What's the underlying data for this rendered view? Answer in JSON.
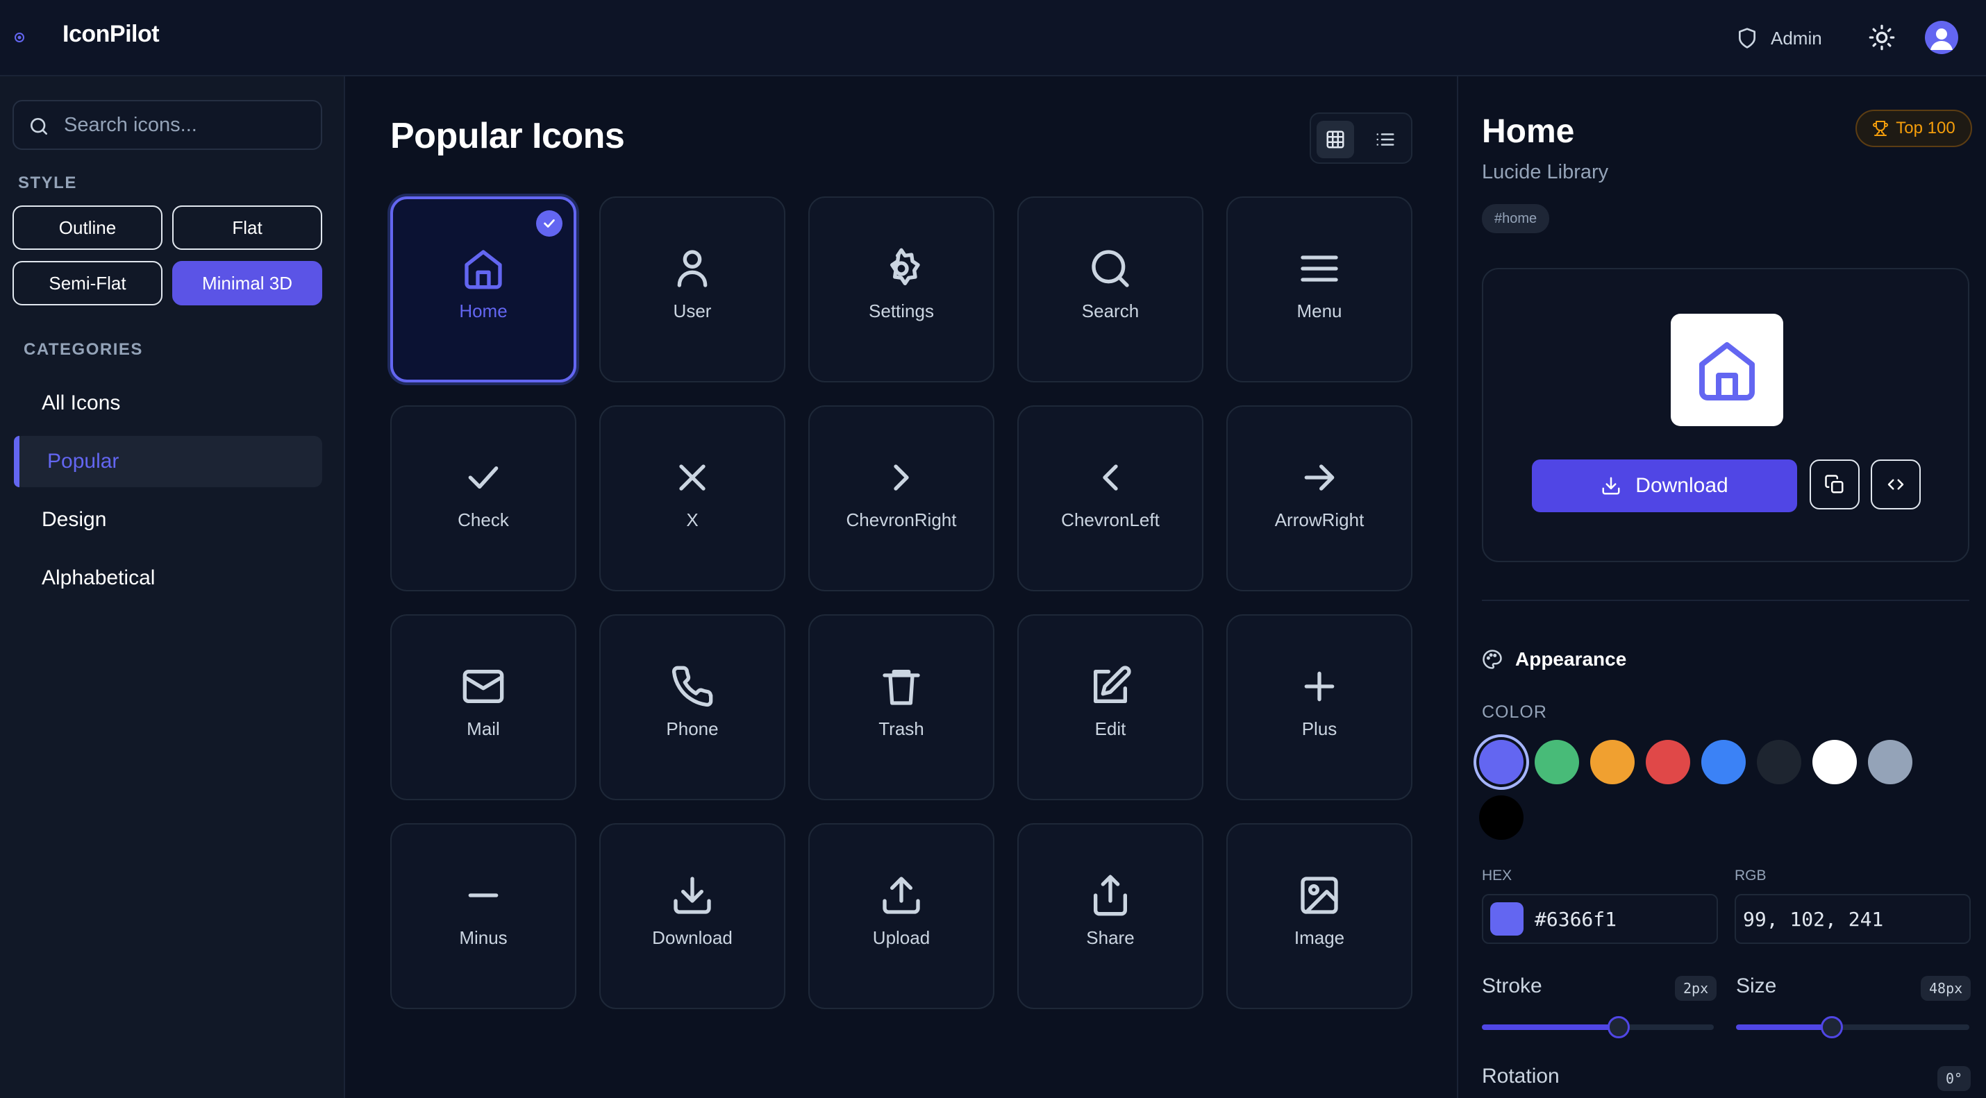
{
  "app": {
    "name": "IconPilot"
  },
  "header": {
    "role_label": "Admin"
  },
  "sidebar": {
    "search_placeholder": "Search icons...",
    "style_label": "STYLE",
    "styles": [
      {
        "label": "Outline",
        "active": false
      },
      {
        "label": "Flat",
        "active": false
      },
      {
        "label": "Semi-Flat",
        "active": false
      },
      {
        "label": "Minimal 3D",
        "active": true
      }
    ],
    "categories_label": "CATEGORIES",
    "categories": [
      {
        "label": "All Icons",
        "active": false
      },
      {
        "label": "Popular",
        "active": true
      },
      {
        "label": "Design",
        "active": false
      },
      {
        "label": "Alphabetical",
        "active": false
      }
    ]
  },
  "main": {
    "title": "Popular Icons",
    "view_mode": "grid",
    "icons": [
      {
        "label": "Home",
        "icon": "home-icon",
        "selected": true
      },
      {
        "label": "User",
        "icon": "user-icon"
      },
      {
        "label": "Settings",
        "icon": "settings-icon"
      },
      {
        "label": "Search",
        "icon": "search-icon"
      },
      {
        "label": "Menu",
        "icon": "menu-icon"
      },
      {
        "label": "Check",
        "icon": "check-icon"
      },
      {
        "label": "X",
        "icon": "x-icon"
      },
      {
        "label": "ChevronRight",
        "icon": "chevron-right-icon"
      },
      {
        "label": "ChevronLeft",
        "icon": "chevron-left-icon"
      },
      {
        "label": "ArrowRight",
        "icon": "arrow-right-icon"
      },
      {
        "label": "Mail",
        "icon": "mail-icon"
      },
      {
        "label": "Phone",
        "icon": "phone-icon"
      },
      {
        "label": "Trash",
        "icon": "trash-icon"
      },
      {
        "label": "Edit",
        "icon": "edit-icon"
      },
      {
        "label": "Plus",
        "icon": "plus-icon"
      },
      {
        "label": "Minus",
        "icon": "minus-icon"
      },
      {
        "label": "Download",
        "icon": "download-icon"
      },
      {
        "label": "Upload",
        "icon": "upload-icon"
      },
      {
        "label": "Share",
        "icon": "share-icon"
      },
      {
        "label": "Image",
        "icon": "image-icon"
      }
    ]
  },
  "detail": {
    "title": "Home",
    "library": "Lucide Library",
    "tag": "#home",
    "badge": "Top 100",
    "download_label": "Download",
    "appearance_label": "Appearance",
    "color_label": "COLOR",
    "colors": [
      "#6366f1",
      "#48bb78",
      "#f0a030",
      "#e04848",
      "#3b82f6",
      "#1e2530",
      "#ffffff",
      "#94a3b8",
      "#000000"
    ],
    "selected_color": "#6366f1",
    "hex_label": "HEX",
    "hex_value": "#6366f1",
    "rgb_label": "RGB",
    "rgb_value": "99, 102, 241",
    "stroke_label": "Stroke",
    "stroke_value": "2px",
    "stroke_fraction": 0.59,
    "size_label": "Size",
    "size_value": "48px",
    "size_fraction": 0.41,
    "rotation_label": "Rotation",
    "rotation_value": "0°"
  },
  "colors": {
    "accent": "#6366f1",
    "button": "#5046e5",
    "badge": "#f59e0b"
  }
}
